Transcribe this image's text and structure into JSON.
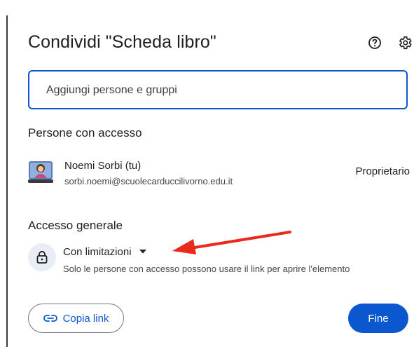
{
  "dialog": {
    "title": "Condividi \"Scheda libro\"",
    "help_icon": "help-circle-icon",
    "settings_icon": "gear-icon"
  },
  "search": {
    "placeholder": "Aggiungi persone e gruppi"
  },
  "people_section": {
    "heading": "Persone con accesso",
    "people": [
      {
        "name": "Noemi Sorbi (tu)",
        "email": "sorbi.noemi@scuolecarduccilivorno.edu.it",
        "role": "Proprietario"
      }
    ]
  },
  "general_access": {
    "heading": "Accesso generale",
    "icon": "lock-icon",
    "selected": "Con limitazioni",
    "description": "Solo le persone con accesso possono usare il link per aprire l'elemento"
  },
  "footer": {
    "copy_link_label": "Copia link",
    "copy_link_icon": "link-icon",
    "done_label": "Fine"
  },
  "colors": {
    "accent": "#0b57d0",
    "annotation_arrow": "#e8291c"
  }
}
